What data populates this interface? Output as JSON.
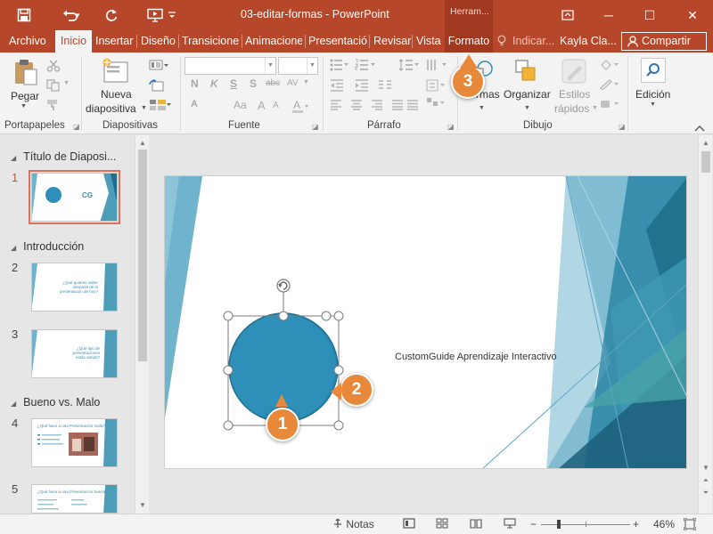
{
  "window": {
    "title": "03-editar-formas  -  PowerPoint",
    "tools_tab": "Herram...",
    "minimize": "─",
    "maximize": "☐",
    "close": "✕",
    "restore": "⧉"
  },
  "qat": {
    "save": "save-icon",
    "undo": "undo-icon",
    "redo": "redo-icon",
    "present": "present-icon"
  },
  "tabs": {
    "archivo": "Archivo",
    "inicio": "Inicio",
    "insertar": "Insertar",
    "diseno": "Diseño",
    "transiciones": "Transiciones",
    "animaciones": "Animaciones",
    "presentacion": "Presentació",
    "revisar": "Revisar",
    "vista": "Vista",
    "formato": "Formato",
    "indicar": "Indicar...",
    "user": "Kayla Cla...",
    "compartir": "Compartir"
  },
  "ribbon": {
    "portapapeles": {
      "label": "Portapapeles",
      "pegar": "Pegar"
    },
    "diapositivas": {
      "label": "Diapositivas",
      "nueva_line1": "Nueva",
      "nueva_line2": "diapositiva"
    },
    "fuente": {
      "label": "Fuente",
      "font_name": "",
      "font_size": "",
      "bold": "N",
      "italic": "K",
      "underline": "S",
      "shadow": "S",
      "strike": "abc",
      "spacing": "AV",
      "grow": "A",
      "shrink": "A",
      "case": "Aa",
      "clear": "A"
    },
    "parrafo": {
      "label": "Párrafo"
    },
    "dibujo": {
      "label": "Dibujo",
      "formas": "Formas",
      "organizar": "Organizar",
      "estilos_line1": "Estilos",
      "estilos_line2": "rápidos"
    },
    "edicion": {
      "label": "Edición"
    }
  },
  "slide_pane": {
    "sections": [
      {
        "title": "Título de Diaposi..."
      },
      {
        "title": "Introducción"
      },
      {
        "title": "Bueno vs. Malo"
      }
    ],
    "slides": [
      {
        "number": "1",
        "text": "CG"
      },
      {
        "number": "2",
        "text": "¿Qué quieres saber después de la presentación de hoy?"
      },
      {
        "number": "3",
        "text": "¿Qué tipo de presentaciones estás dando?"
      },
      {
        "number": "4",
        "text": "¿Qué hace a una Presentación mala?"
      },
      {
        "number": "5",
        "text": "¿Qué hace a una Presentación buena?"
      }
    ]
  },
  "slide": {
    "text": "CustomGuide Aprendizaje Interactivo",
    "circle_color": "#2e8fb8",
    "accent_colors": [
      "#2e8fb8",
      "#5aa6c2",
      "#1e6f8c",
      "#4a9bb6"
    ]
  },
  "callouts": {
    "one": "1",
    "two": "2",
    "three": "3",
    "color": "#e8883a"
  },
  "statusbar": {
    "notas": "Notas",
    "zoom": "46%",
    "minus": "−",
    "plus": "+"
  }
}
